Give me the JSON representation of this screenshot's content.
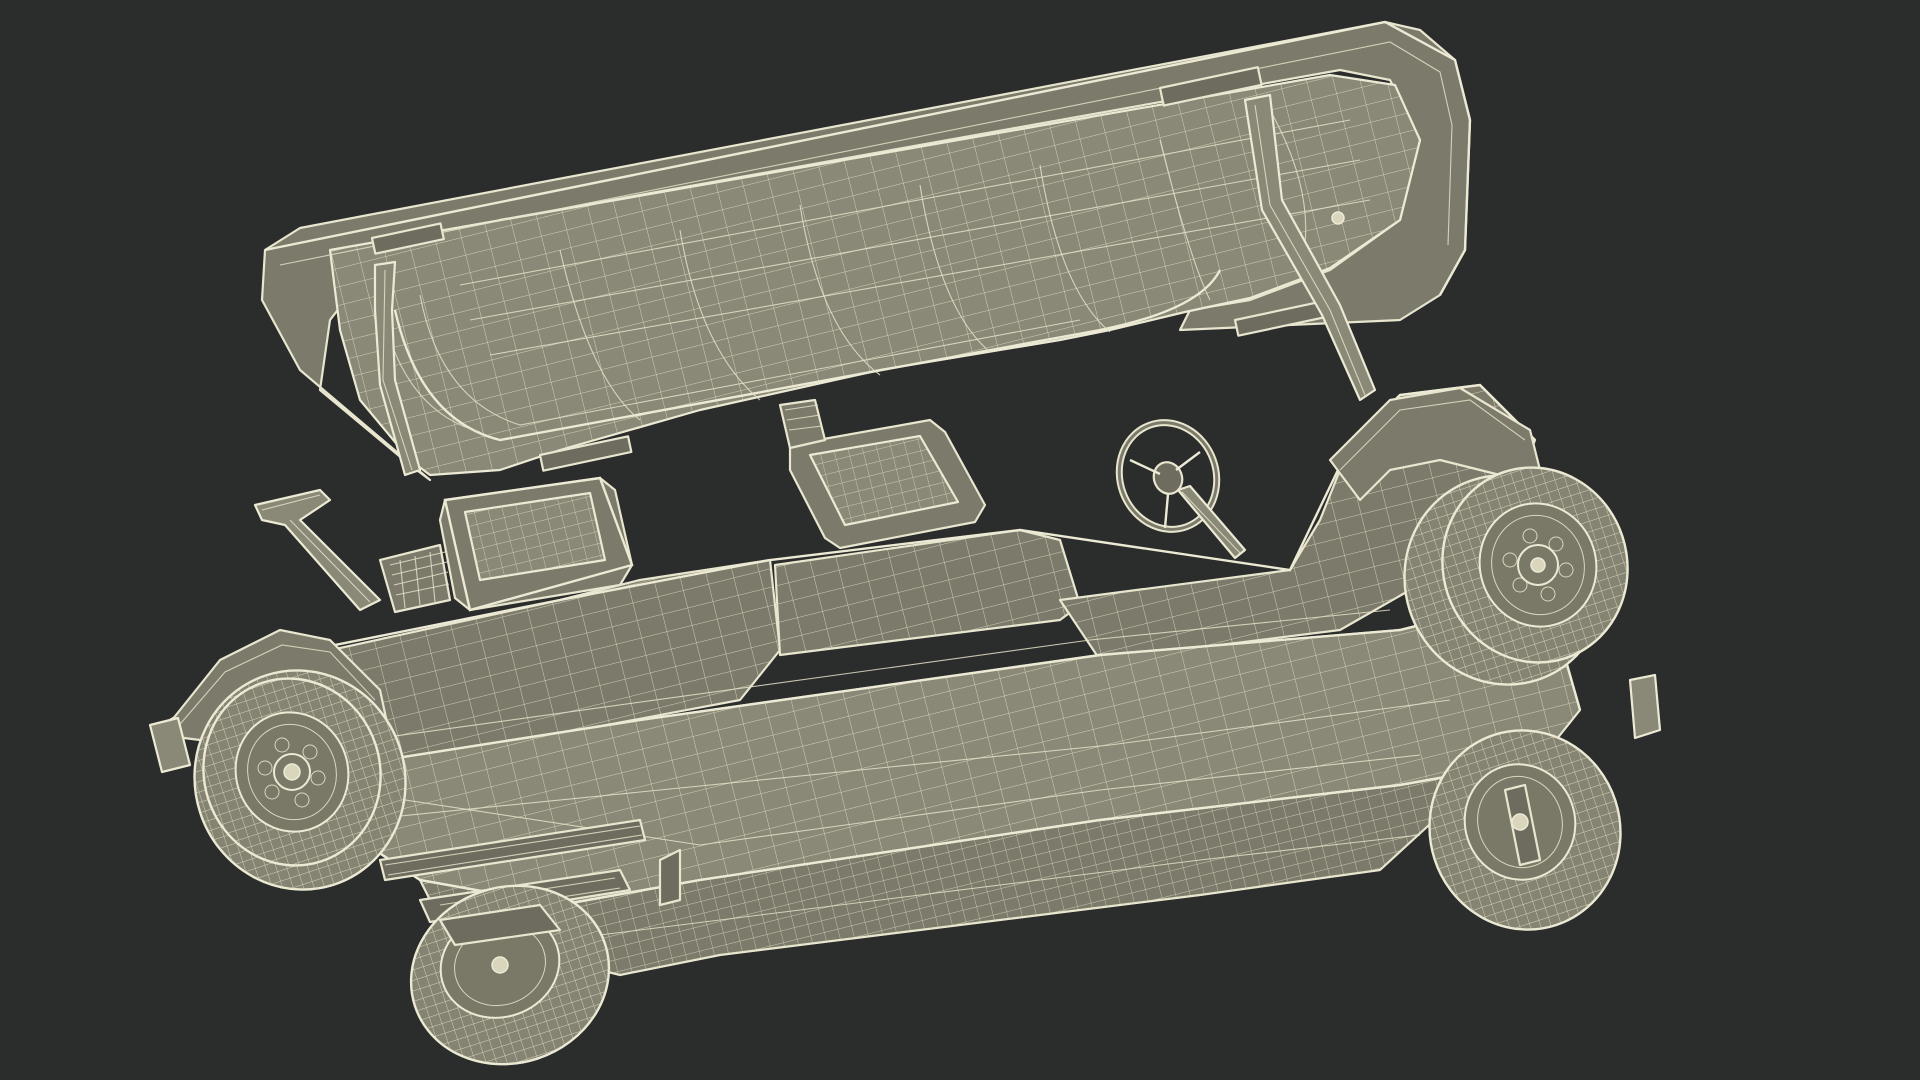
{
  "scene": {
    "subject": "golf-cart-wireframe",
    "background_color": "#2b2c2c",
    "mesh_fill_color": "#7c7b6b",
    "wire_color": "#e9e6cf"
  }
}
